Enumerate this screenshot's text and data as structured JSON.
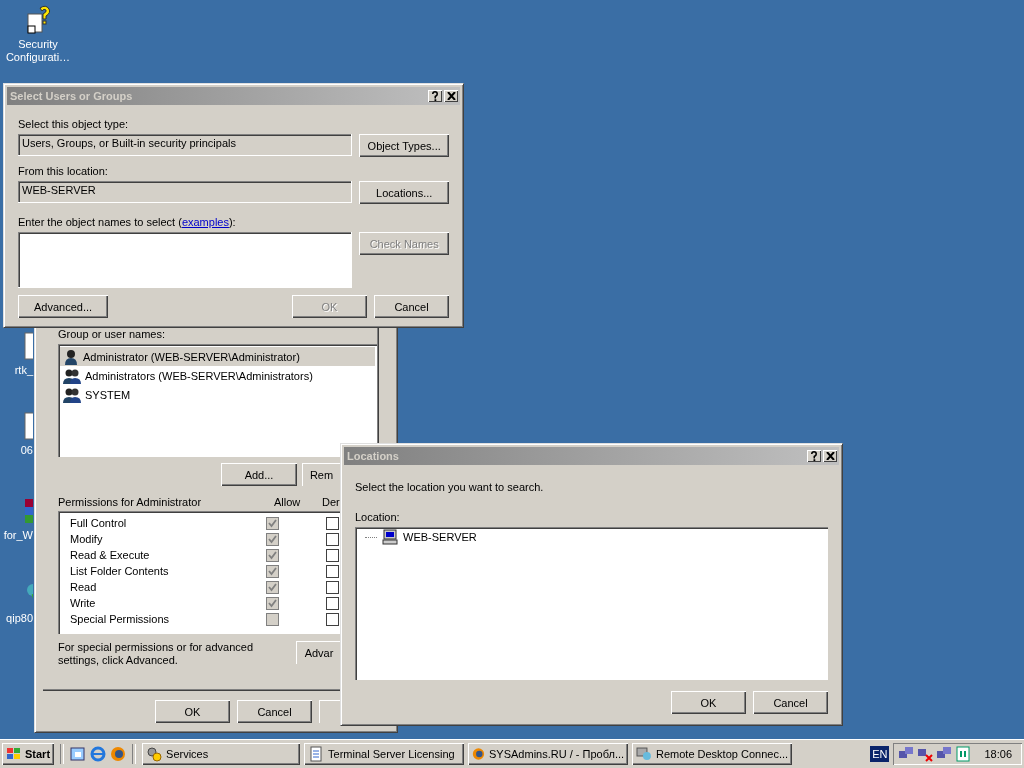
{
  "desktop_icons": [
    {
      "label": "Security Configurati…",
      "kind": "shortcut"
    },
    {
      "label": "rtk_",
      "kind": "document"
    },
    {
      "label": "06",
      "kind": "document"
    },
    {
      "label": "for_W",
      "kind": "archive"
    },
    {
      "label": "qip80",
      "kind": "program"
    }
  ],
  "properties_window": {
    "group_label": "Group or user names:",
    "users": [
      {
        "name": "Administrator (WEB-SERVER\\Administrator)",
        "kind": "user",
        "selected": true
      },
      {
        "name": "Administrators (WEB-SERVER\\Administrators)",
        "kind": "group",
        "selected": false
      },
      {
        "name": "SYSTEM",
        "kind": "group",
        "selected": false
      }
    ],
    "add_button": "Add...",
    "remove_button": "Rem",
    "permissions_label": "Permissions for Administrator",
    "column_allow": "Allow",
    "column_deny": "Der",
    "permissions": [
      {
        "name": "Full Control",
        "allow": true,
        "deny": false,
        "disabled": true
      },
      {
        "name": "Modify",
        "allow": true,
        "deny": false,
        "disabled": true
      },
      {
        "name": "Read & Execute",
        "allow": true,
        "deny": false,
        "disabled": true
      },
      {
        "name": "List Folder Contents",
        "allow": true,
        "deny": false,
        "disabled": true
      },
      {
        "name": "Read",
        "allow": true,
        "deny": false,
        "disabled": true
      },
      {
        "name": "Write",
        "allow": true,
        "deny": false,
        "disabled": true
      },
      {
        "name": "Special Permissions",
        "allow": false,
        "deny": false,
        "disabled": true
      }
    ],
    "advanced_note": "For special permissions or for advanced settings, click Advanced.",
    "advanced_button": "Advar",
    "footer_buttons": [
      "OK",
      "Cancel"
    ]
  },
  "select_dialog": {
    "title": "Select Users or Groups",
    "object_type_label": "Select this object type:",
    "object_type_value": "Users, Groups, or Built-in security principals",
    "object_types_button": "Object Types...",
    "location_label": "From this location:",
    "location_value": "WEB-SERVER",
    "locations_button": "Locations...",
    "examples_link": "examples",
    "names_label_start": "Enter the object names to select (",
    "names_label_end": "):",
    "check_names_button": {
      "label": "Check Names",
      "disabled": true
    },
    "advanced_button": "Advanced...",
    "ok_button": {
      "label": "OK",
      "disabled": true
    },
    "cancel_button": "Cancel"
  },
  "locations_dialog": {
    "title": "Locations",
    "prompt": "Select the location you want to search.",
    "location_label": "Location:",
    "tree": [
      {
        "label": "WEB-SERVER",
        "kind": "computer"
      }
    ],
    "ok_button": "OK",
    "cancel_button": "Cancel"
  },
  "taskbar": {
    "start": "Start",
    "tasks": [
      {
        "label": "Services",
        "kind": "gears",
        "selected": false
      },
      {
        "label": "Terminal Server Licensing",
        "kind": "licensing",
        "selected": false
      },
      {
        "label": "SYSAdmins.RU / - Пробл...",
        "kind": "browser",
        "selected": false
      },
      {
        "label": "Remote Desktop Connec...",
        "kind": "remote",
        "selected": false
      }
    ],
    "language": "EN",
    "clock": "18:06"
  }
}
